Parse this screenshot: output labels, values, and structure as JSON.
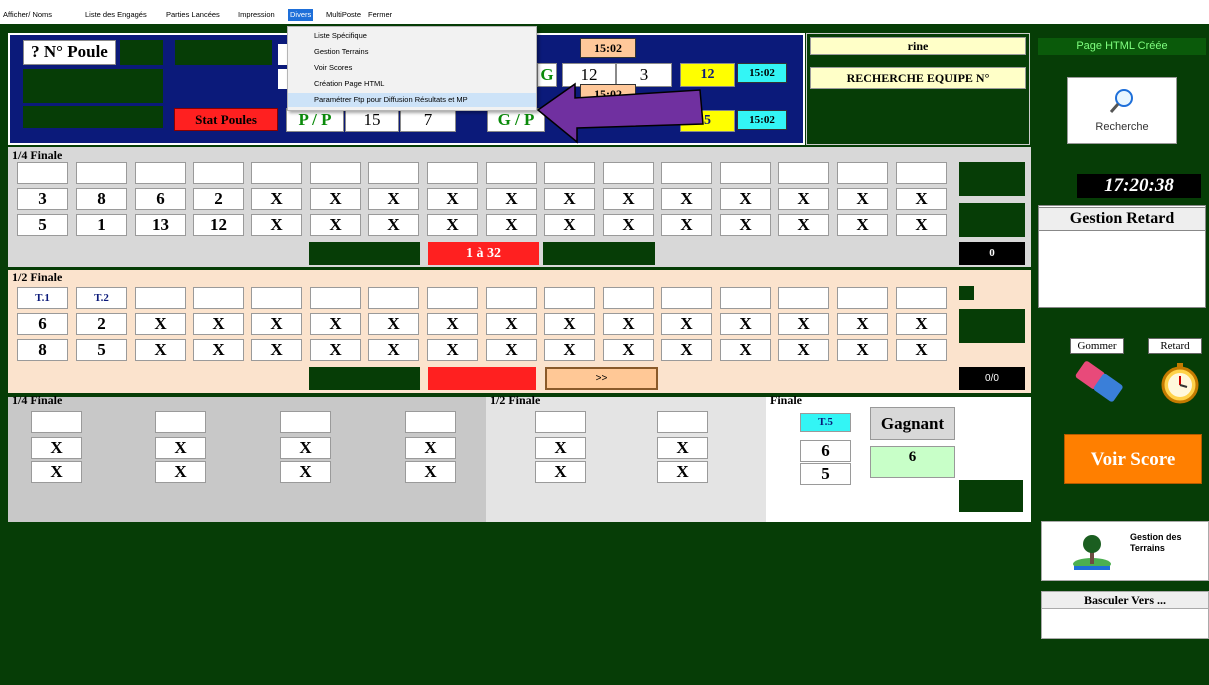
{
  "menu": {
    "items": [
      "Afficher/ Noms",
      "Liste des Engagés",
      "Parties Lancées",
      "Impression",
      "Divers",
      "MultiPoste",
      "Fermer"
    ],
    "active": "Divers",
    "dropdown": [
      "Liste Spécifique",
      "Gestion Terrains",
      "Voir Scores",
      "Création Page HTML",
      "Paramétrer Ftp pour Diffusion Résultats et MP"
    ],
    "highlighted": "Paramétrer Ftp pour Diffusion Résultats et MP"
  },
  "header": {
    "poule_label": "? N° Poule",
    "stat_poules": "Stat Poules",
    "pp_label": "P / P",
    "pp_values": [
      "15",
      "7"
    ],
    "gp_label": "G / P",
    "g_label": "G",
    "g_values": [
      "12",
      "3"
    ],
    "score_yellow_1": "12",
    "score_yellow_2": "5",
    "times": [
      "15:02",
      "15:02",
      "15:02",
      "15:02"
    ],
    "rine_label": "rine",
    "recherche_equipe": "RECHERCHE EQUIPE N°"
  },
  "right": {
    "html_status": "Page HTML Créée",
    "recherche": "Recherche",
    "clock": "17:20:38",
    "gestion_retard": "Gestion Retard",
    "gommer": "Gommer",
    "retard": "Retard",
    "voir_score": "Voir Score",
    "gestion_terrains": "Gestion des Terrains",
    "basculer": "Basculer Vers ..."
  },
  "quart_finale": {
    "label": "1/4 Finale",
    "row1": [
      "3",
      "8",
      "6",
      "2",
      "X",
      "X",
      "X",
      "X",
      "X",
      "X",
      "X",
      "X",
      "X",
      "X",
      "X",
      "X"
    ],
    "row2": [
      "5",
      "1",
      "13",
      "12",
      "X",
      "X",
      "X",
      "X",
      "X",
      "X",
      "X",
      "X",
      "X",
      "X",
      "X",
      "X"
    ],
    "range_label": "1 à 32",
    "counter": "0"
  },
  "demi_finale": {
    "label": "1/2 Finale",
    "tables": [
      "T.1",
      "T.2"
    ],
    "row1": [
      "6",
      "2",
      "X",
      "X",
      "X",
      "X",
      "X",
      "X",
      "X",
      "X",
      "X",
      "X",
      "X",
      "X",
      "X",
      "X"
    ],
    "row2": [
      "8",
      "5",
      "X",
      "X",
      "X",
      "X",
      "X",
      "X",
      "X",
      "X",
      "X",
      "X",
      "X",
      "X",
      "X",
      "X"
    ],
    "next_button": ">>",
    "counter": "0/0"
  },
  "bottom": {
    "quart_label": "1/4 Finale",
    "quart_values": [
      [
        "X",
        "X"
      ],
      [
        "X",
        "X"
      ],
      [
        "X",
        "X"
      ],
      [
        "X",
        "X"
      ]
    ],
    "demi_label": "1/2 Finale",
    "demi_values": [
      [
        "X",
        "X"
      ],
      [
        "X",
        "X"
      ]
    ],
    "finale_label": "Finale",
    "finale_table": "T.5",
    "finale_values": [
      "6",
      "5"
    ],
    "gagnant_label": "Gagnant",
    "gagnant_value": "6"
  },
  "colors": {
    "dark_green": "#063d06",
    "navy": "#0b1a7a",
    "light_yellow": "#ffffc8",
    "cyan": "#33f5f5",
    "red": "#ff2020",
    "orange": "#ff7f00",
    "purple_arrow": "#7030a0",
    "peach": "#fbe3cd"
  }
}
